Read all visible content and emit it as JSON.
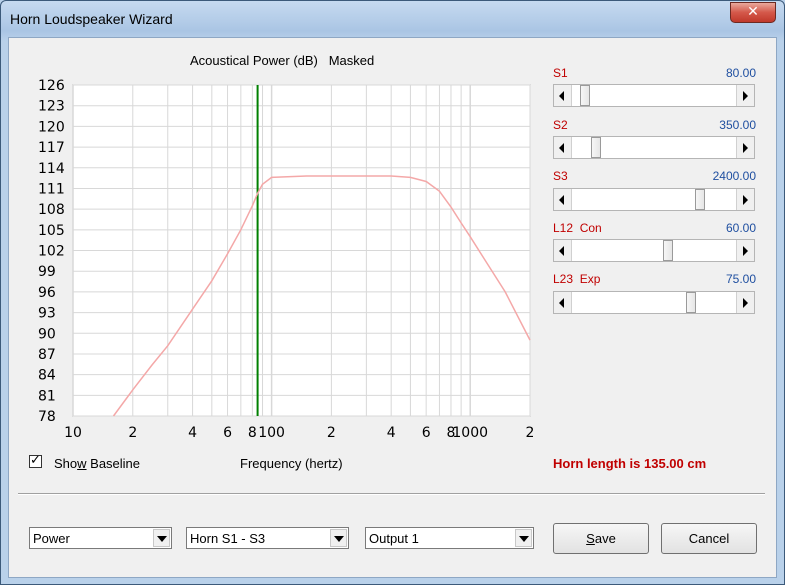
{
  "window": {
    "title": "Horn Loudspeaker Wizard",
    "close_glyph": "✕"
  },
  "chart_data": {
    "type": "line",
    "title": "Acoustical Power (dB)   Masked",
    "xlabel": "Frequency (hertz)",
    "ylabel": "",
    "x_scale": "log",
    "xlim": [
      10,
      2000
    ],
    "ylim": [
      78,
      126
    ],
    "y_ticks": [
      "126",
      "123",
      "120",
      "117",
      "114",
      "111",
      "108",
      "105",
      "102",
      "99",
      "96",
      "93",
      "90",
      "87",
      "84",
      "81",
      "78"
    ],
    "x_ticks": [
      {
        "value": 10,
        "label": "10"
      },
      {
        "value": 20,
        "label": "2"
      },
      {
        "value": 40,
        "label": "4"
      },
      {
        "value": 60,
        "label": "6"
      },
      {
        "value": 80,
        "label": "8"
      },
      {
        "value": 100,
        "label": "100"
      },
      {
        "value": 200,
        "label": "2"
      },
      {
        "value": 400,
        "label": "4"
      },
      {
        "value": 600,
        "label": "6"
      },
      {
        "value": 800,
        "label": "8"
      },
      {
        "value": 1000,
        "label": "1000"
      },
      {
        "value": 2000,
        "label": "2"
      }
    ],
    "grid": true,
    "marker_frequency": 85,
    "marker_color": "#008000",
    "series": [
      {
        "color": "#f4a8a8",
        "x": [
          16,
          20,
          25,
          30,
          40,
          50,
          60,
          70,
          80,
          85,
          90,
          100,
          150,
          200,
          300,
          400,
          500,
          600,
          700,
          800,
          900,
          1000,
          1200,
          1500,
          2000
        ],
        "y": [
          78,
          81.8,
          85.4,
          88.2,
          93.5,
          97.6,
          101.5,
          105.0,
          108.5,
          110.3,
          111.6,
          112.6,
          112.8,
          112.8,
          112.8,
          112.8,
          112.6,
          112.0,
          110.6,
          108.3,
          106.0,
          104.0,
          100.4,
          96.0,
          89.0
        ]
      }
    ]
  },
  "checkbox": {
    "label_pre": "Sho",
    "label_ul": "w",
    "label_post": " Baseline",
    "checked_glyph": "✓"
  },
  "horn_length": "Horn length is 135.00 cm",
  "sliders": [
    {
      "label": "S1",
      "value": "80.00",
      "position": 0.05
    },
    {
      "label": "S2",
      "value": "350.00",
      "position": 0.12
    },
    {
      "label": "S3",
      "value": "2400.00",
      "position": 0.79
    },
    {
      "label": "L12  Con",
      "value": "60.00",
      "position": 0.58
    },
    {
      "label": "L23  Exp",
      "value": "75.00",
      "position": 0.73
    }
  ],
  "dropdowns": [
    {
      "value": "Power"
    },
    {
      "value": "Horn S1 - S3"
    },
    {
      "value": "Output 1"
    }
  ],
  "buttons": {
    "save_pre": "",
    "save_ul": "S",
    "save_post": "ave",
    "cancel": "Cancel"
  }
}
